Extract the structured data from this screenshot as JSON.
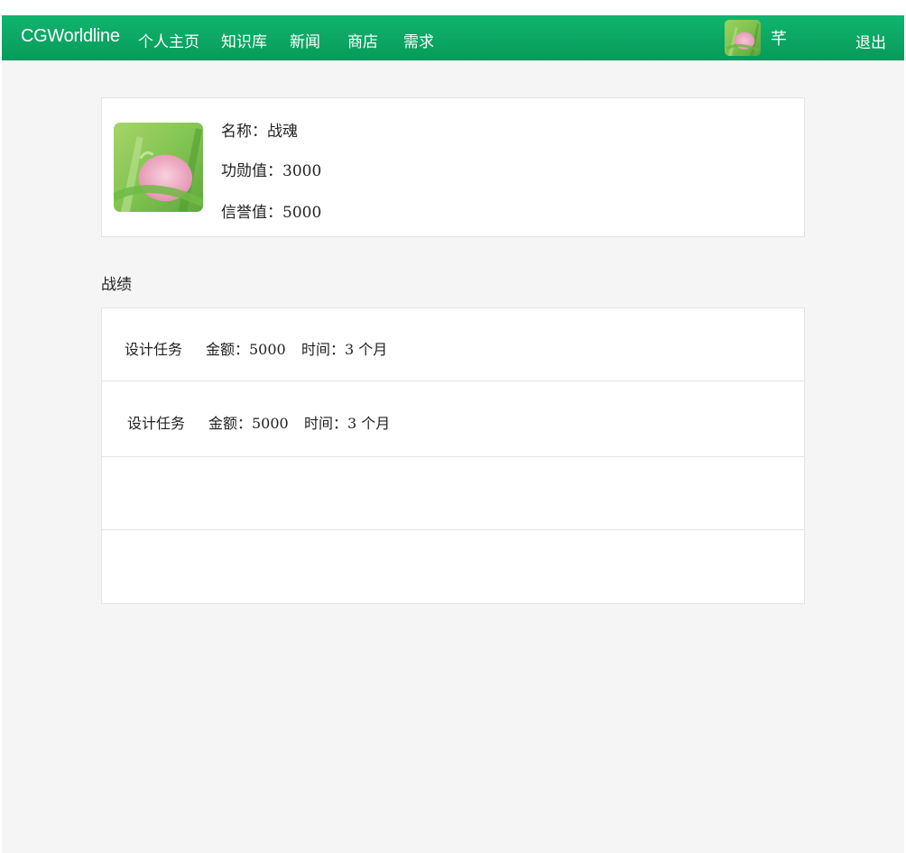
{
  "navbar": {
    "brand": "CGWorldline",
    "links": [
      "个人主页",
      "知识库",
      "新闻",
      "商店",
      "需求"
    ],
    "user_name": "芊",
    "logout": "退出",
    "accent_color": "#0aa862"
  },
  "profile": {
    "name_label": "名称：战魂",
    "merit_label": "功勋值：3000",
    "credit_label": "信誉值：5000"
  },
  "records": {
    "title": "战绩",
    "rows": [
      {
        "task": "设计任务",
        "amount": "金额：5000",
        "time": "时间：3 个月"
      },
      {
        "task": "设计任务",
        "amount": "金额：5000",
        "time": "时间：3 个月"
      },
      {
        "task": "",
        "amount": "",
        "time": ""
      },
      {
        "task": "",
        "amount": "",
        "time": ""
      }
    ]
  }
}
